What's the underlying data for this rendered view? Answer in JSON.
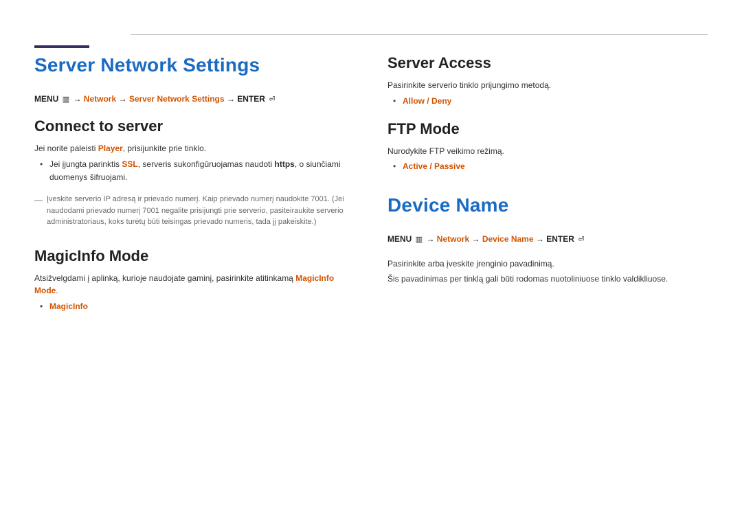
{
  "left": {
    "title": "Server Network Settings",
    "bc": {
      "menu": "MENU",
      "menu_icon": "▥",
      "arrow": "→",
      "path1": "Network",
      "path2": "Server Network Settings",
      "enter": "ENTER",
      "enter_icon": "⏎"
    },
    "connect": {
      "heading": "Connect to server",
      "p1": {
        "pre": "Jei norite paleisti ",
        "player": "Player",
        "post": ", prisijunkite prie tinklo."
      },
      "bullet1": {
        "pre": "Jei įjungta parinktis ",
        "ssl": "SSL",
        "mid": ", serveris sukonfigūruojamas naudoti ",
        "https": "https",
        "post": ", o siunčiami duomenys šifruojami."
      },
      "note": "Įveskite serverio IP adresą ir prievado numerį. Kaip prievado numerį naudokite 7001. (Jei naudodami prievado numerį 7001 negalite prisijungti prie serverio, pasiteiraukite serverio administratoriaus, koks turėtų būti teisingas prievado numeris, tada jį pakeiskite.)"
    },
    "magicinfo": {
      "heading": "MagicInfo Mode",
      "p1": {
        "pre": "Atsižvelgdami į aplinką, kurioje naudojate gaminį, pasirinkite atitinkamą ",
        "mode": "MagicInfo Mode",
        "post": "."
      },
      "bullet1": "MagicInfo"
    }
  },
  "right": {
    "server_access": {
      "heading": "Server Access",
      "p1": "Pasirinkite serverio tinklo prijungimo metodą.",
      "bullet1": "Allow / Deny"
    },
    "ftp_mode": {
      "heading": "FTP Mode",
      "p1": "Nurodykite FTP veikimo režimą.",
      "bullet1": "Active / Passive"
    },
    "device_name": {
      "title": "Device Name",
      "bc": {
        "menu": "MENU",
        "menu_icon": "▥",
        "arrow": "→",
        "path1": "Network",
        "path2": "Device Name",
        "enter": "ENTER",
        "enter_icon": "⏎"
      },
      "p1": "Pasirinkite arba įveskite įrenginio pavadinimą.",
      "p2": "Šis pavadinimas per tinklą gali būti rodomas nuotoliniuose tinklo valdikliuose."
    }
  }
}
